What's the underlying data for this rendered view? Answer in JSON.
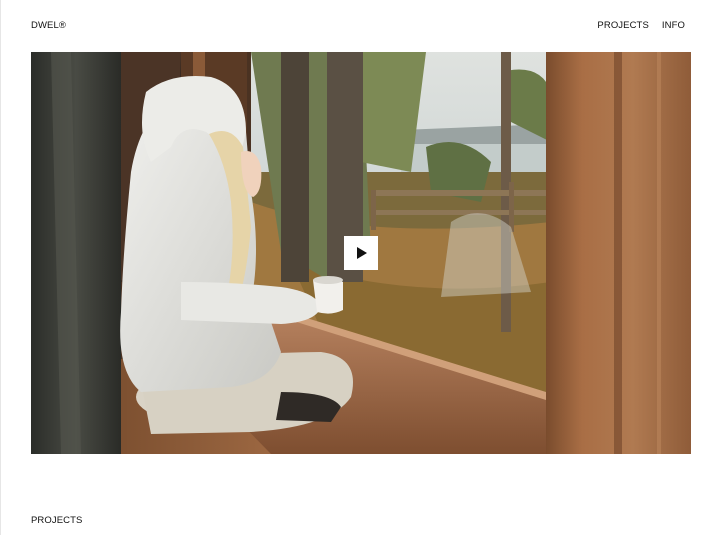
{
  "header": {
    "brand": "DWEL®",
    "nav": {
      "projects": "PROJECTS",
      "info": "INFO"
    }
  },
  "hero": {
    "icons": {
      "play": "play-icon"
    }
  },
  "sections": {
    "projects_label": "PROJECTS"
  }
}
